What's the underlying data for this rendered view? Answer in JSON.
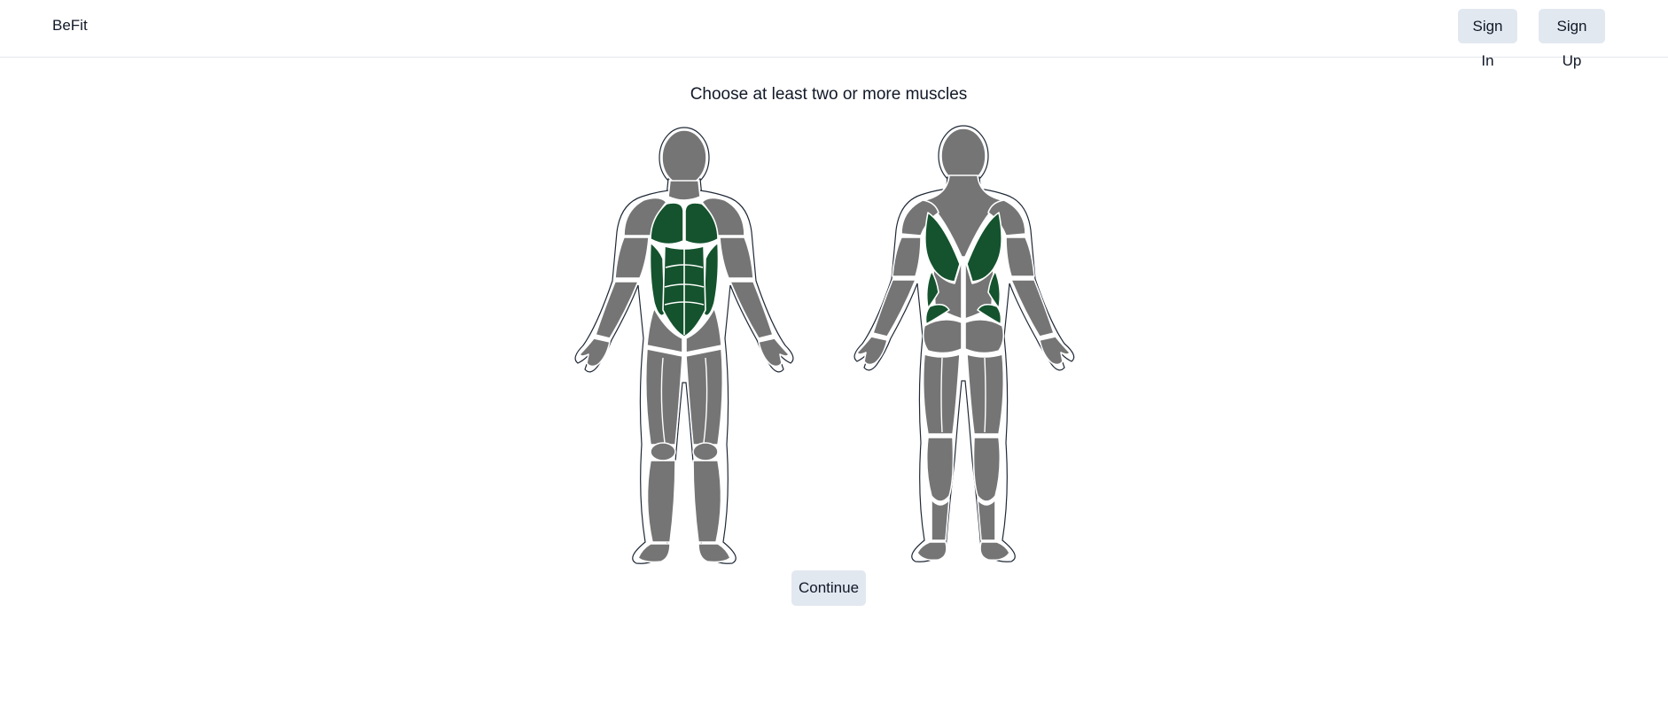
{
  "navbar": {
    "brand": "BeFit",
    "sign_in_label": "Sign In",
    "sign_up_label": "Sign Up"
  },
  "prompt": "Choose at least two or more muscles",
  "continue_label": "Continue",
  "colors": {
    "selected_muscle": "#14532d",
    "unselected_muscle": "#757575",
    "button_bg": "#e2e8f0",
    "outline": "#ffffff"
  },
  "muscles": {
    "front": {
      "chest": "selected",
      "abs": "selected",
      "obliques": "selected",
      "shoulders": "unselected",
      "biceps": "unselected",
      "forearms": "unselected",
      "quads": "unselected",
      "calves": "unselected"
    },
    "back": {
      "lats": "selected",
      "lower_back": "selected",
      "traps": "unselected",
      "rear_delts": "unselected",
      "triceps": "unselected",
      "glutes": "unselected",
      "hamstrings": "unselected",
      "calves": "unselected"
    }
  }
}
